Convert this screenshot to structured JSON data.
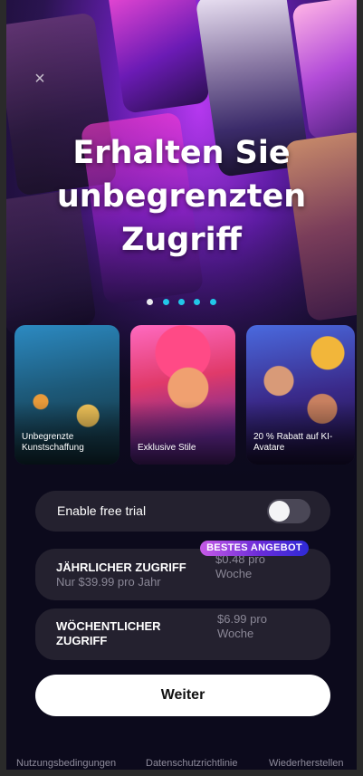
{
  "hero": {
    "title_line1": "Erhalten Sie",
    "title_line2": "unbegrenzten",
    "title_line3": "Zugriff",
    "close_icon": "×"
  },
  "carousel": {
    "dot_count": 5,
    "active_index": 0
  },
  "features": [
    {
      "label": "Unbegrenzte Kunstschaffung"
    },
    {
      "label": "Exklusive Stile"
    },
    {
      "label": "20 % Rabatt auf KI-Avatare"
    }
  ],
  "trial": {
    "label": "Enable free trial",
    "enabled": false
  },
  "plans": {
    "yearly": {
      "name": "JÄHRLICHER ZUGRIFF",
      "sub": "Nur $39.99 pro Jahr",
      "price": "$0.48 pro Woche",
      "badge": "BESTES ANGEBOT"
    },
    "weekly": {
      "name": "WÖCHENTLICHER ZUGRIFF",
      "price": "$6.99 pro Woche"
    }
  },
  "cta": {
    "label": "Weiter"
  },
  "footer": {
    "terms": "Nutzungsbedingungen",
    "privacy": "Datenschutzrichtlinie",
    "restore": "Wiederherstellen"
  },
  "colors": {
    "background": "#0c0a1c",
    "card": "#24212f",
    "dot_inactive": "#22c7e8",
    "dot_active": "#e9e9ee",
    "badge_gradient_start": "#c65ae6",
    "badge_gradient_end": "#2e2ad6"
  }
}
